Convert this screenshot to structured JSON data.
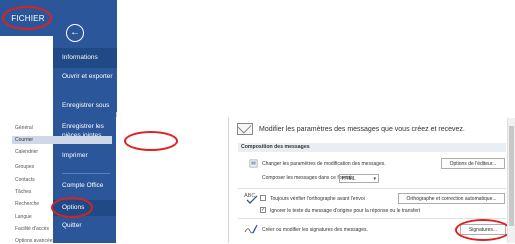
{
  "file_tab": {
    "label": "FICHIER"
  },
  "backstage": {
    "back_icon": "arrow-left-icon",
    "items": [
      {
        "label": "Informations"
      },
      {
        "label": "Ouvrir et exporter"
      },
      {
        "label": "Enregistrer sous"
      },
      {
        "label": "Enregistrer les pièces jointes"
      },
      {
        "label": "Imprimer"
      },
      {
        "label": "Compte Office"
      },
      {
        "label": "Options"
      },
      {
        "label": "Quitter"
      }
    ]
  },
  "options": {
    "categories": [
      {
        "label": "Général"
      },
      {
        "label": "Courrier"
      },
      {
        "label": "Calendrier"
      },
      {
        "label": "Groupes"
      },
      {
        "label": "Contacts"
      },
      {
        "label": "Tâches"
      },
      {
        "label": "Recherche"
      },
      {
        "label": "Langue"
      },
      {
        "label": "Facilité d'accès"
      },
      {
        "label": "Options avancées"
      }
    ],
    "header": "Modifier les paramètres des messages que vous créez et recevez.",
    "section": "Composition des messages",
    "editor_text": "Changer les paramètres de modification des messages.",
    "editor_button": "Options de l'éditeur...",
    "compose_label": "Composer les messages dans ce format :",
    "compose_format": "HTML",
    "check1": "Toujours vérifier l'orthographe avant l'envoi",
    "check2": "Ignorer le texte du message d'origine pour la réponse ou le transfert",
    "spell_button": "Orthographe et correction automatique...",
    "signatures_text": "Créer ou modifier les signatures des messages.",
    "signatures_button": "Signatures..."
  },
  "colors": {
    "backstage": "#2b579a",
    "highlight": "#e02020"
  }
}
